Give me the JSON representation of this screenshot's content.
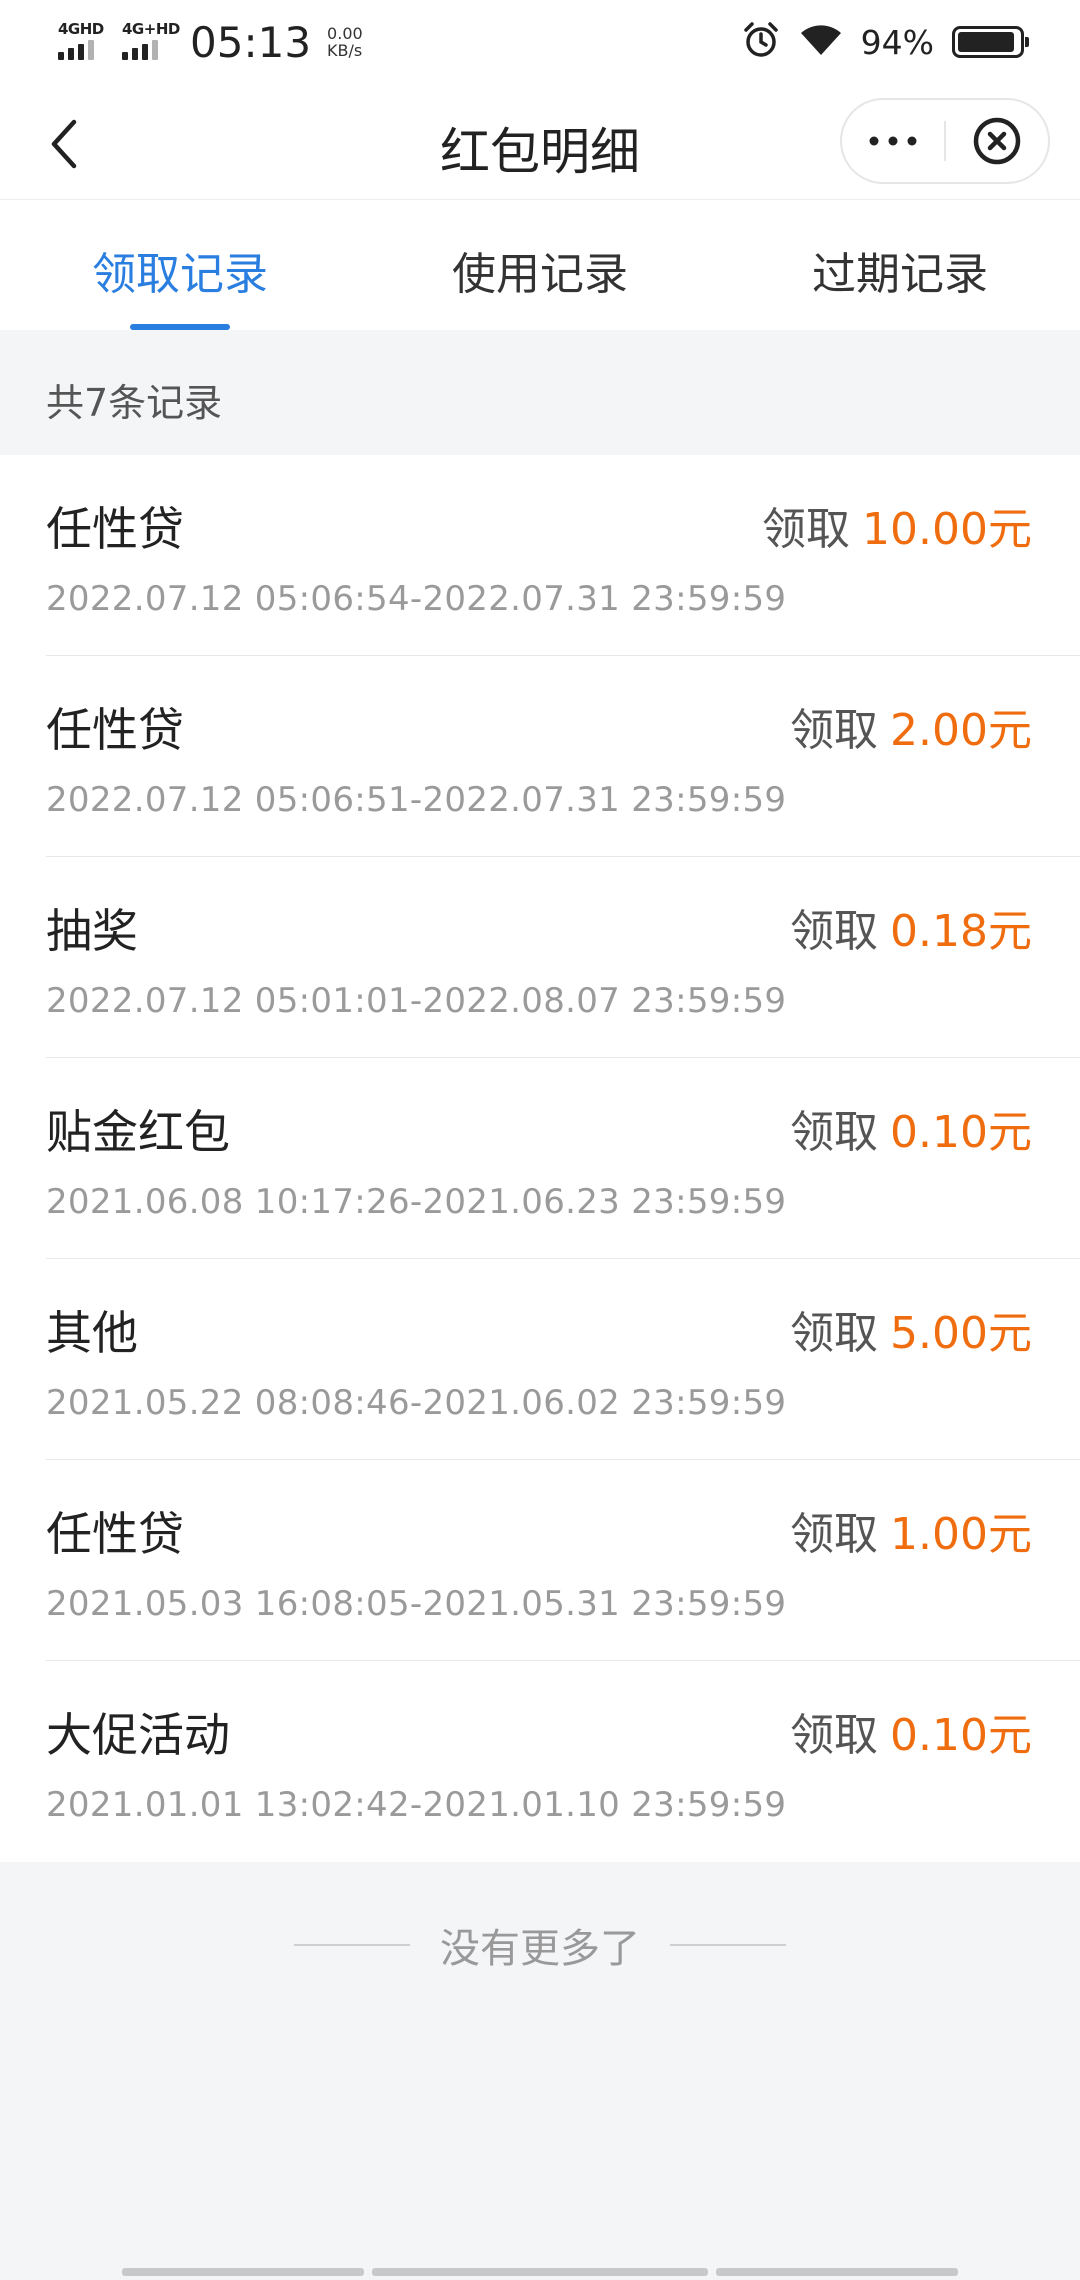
{
  "status_bar": {
    "sim1": "4GHD",
    "sim2": "4G+HD",
    "time": "05:13",
    "speed_value": "0.00",
    "speed_unit": "KB/s",
    "battery_text": "94%",
    "battery_level": 0.94
  },
  "navbar": {
    "title": "红包明细"
  },
  "tabs": [
    {
      "label": "领取记录",
      "active": true
    },
    {
      "label": "使用记录",
      "active": false
    },
    {
      "label": "过期记录",
      "active": false
    }
  ],
  "summary": {
    "text": "共7条记录"
  },
  "records": [
    {
      "name": "任性贷",
      "action": "领取",
      "amount": "10.00元",
      "range": "2022.07.12 05:06:54-2022.07.31 23:59:59"
    },
    {
      "name": "任性贷",
      "action": "领取",
      "amount": "2.00元",
      "range": "2022.07.12 05:06:51-2022.07.31 23:59:59"
    },
    {
      "name": "抽奖",
      "action": "领取",
      "amount": "0.18元",
      "range": "2022.07.12 05:01:01-2022.08.07 23:59:59"
    },
    {
      "name": "贴金红包",
      "action": "领取",
      "amount": "0.10元",
      "range": "2021.06.08 10:17:26-2021.06.23 23:59:59"
    },
    {
      "name": "其他",
      "action": "领取",
      "amount": "5.00元",
      "range": "2021.05.22 08:08:46-2021.06.02 23:59:59"
    },
    {
      "name": "任性贷",
      "action": "领取",
      "amount": "1.00元",
      "range": "2021.05.03 16:08:05-2021.05.31 23:59:59"
    },
    {
      "name": "大促活动",
      "action": "领取",
      "amount": "0.10元",
      "range": "2021.01.01 13:02:42-2021.01.10 23:59:59"
    }
  ],
  "footer": {
    "no_more_text": "没有更多了"
  },
  "colors": {
    "accent": "#2a7ee0",
    "amount": "#f06d0f",
    "background": "#f4f5f7"
  },
  "icons": {
    "back": "chevron-left-icon",
    "more": "more-dots-icon",
    "close": "close-circle-icon",
    "alarm": "alarm-icon",
    "wifi": "wifi-icon",
    "battery": "battery-icon"
  }
}
